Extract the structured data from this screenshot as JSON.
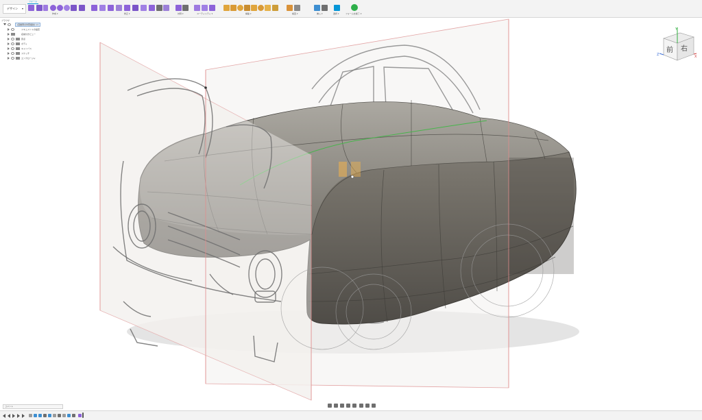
{
  "workspace": {
    "label": "デザイン"
  },
  "tabs": [
    {
      "label": "フォーム"
    }
  ],
  "toolbar_groups": [
    {
      "label": "作成 ▾"
    },
    {
      "label": "修正 ▾"
    },
    {
      "label": "対称 ▾"
    },
    {
      "label": "ユーティリティ ▾"
    },
    {
      "label": "構築 ▾"
    },
    {
      "label": "検査 ▾"
    },
    {
      "label": "挿入 ▾"
    },
    {
      "label": "選択 ▾"
    },
    {
      "label": "フォームを終了 ▾"
    }
  ],
  "browser": {
    "header": "ブラウザ",
    "root": "(自動車の外形検討) v1",
    "items": [
      {
        "label": "ドキュメントの設定"
      },
      {
        "label": "名前付きビュー"
      },
      {
        "label": "原点"
      },
      {
        "label": "ボディ"
      },
      {
        "label": "キャンバス"
      },
      {
        "label": "スケッチ"
      },
      {
        "label": "エンクロージャ"
      }
    ]
  },
  "viewcube": {
    "front": "前",
    "right": "右",
    "axis_x": "X",
    "axis_y": "Y",
    "axis_z": "Z"
  },
  "comments": {
    "label": "コメント"
  },
  "colors": {
    "accent": "#0696d7",
    "form_tools": "#8d63d9",
    "body_surface": "#6f6b63",
    "finish_form": "#2eaf4a",
    "canvas_outline": "#e3a4a4"
  }
}
